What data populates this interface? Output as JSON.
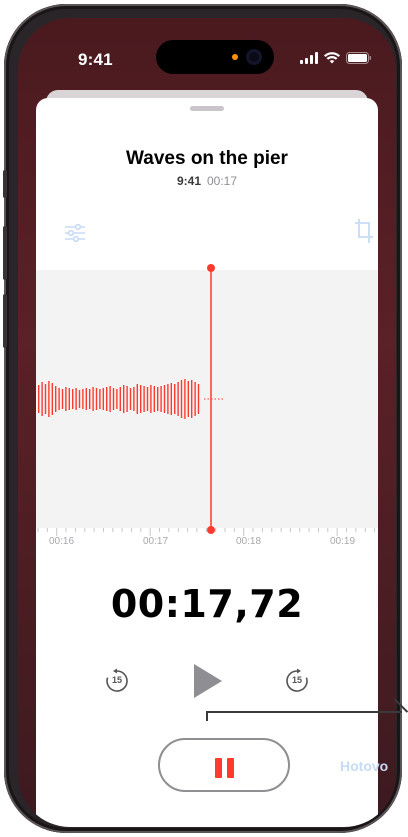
{
  "status_bar": {
    "time": "9:41"
  },
  "recording": {
    "title": "Waves on the pier",
    "time": "9:41",
    "duration": "00:17"
  },
  "timeline": {
    "labels": [
      "00:16",
      "00:17",
      "00:18",
      "00:19"
    ]
  },
  "timer": "00:17,72",
  "controls": {
    "skip_back": "15",
    "skip_forward": "15"
  },
  "done_label": "Hotovo",
  "colors": {
    "accent": "#ff3b30",
    "done": "#c7dbf5"
  }
}
